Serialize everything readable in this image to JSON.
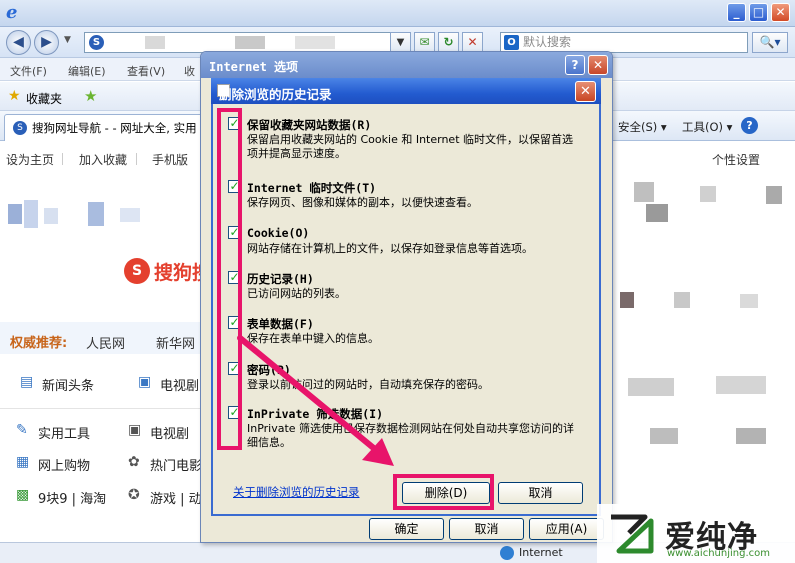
{
  "browser": {
    "window_controls": {
      "minimize": "_",
      "maximize": "□",
      "close": "✕"
    },
    "nav": {
      "back": "◀",
      "forward": "▶",
      "dropdown": "▼"
    },
    "address_site_icon": "S",
    "toolbar_icons": {
      "compat": "✉",
      "refresh": "↻",
      "stop": "✕"
    },
    "search": {
      "placeholder": "默认搜索",
      "engine_icon": "O",
      "button": "🔍▾"
    },
    "menu": [
      "文件(F)",
      "编辑(E)",
      "查看(V)",
      "收"
    ],
    "favorites": {
      "label": "收藏夹"
    },
    "tab": {
      "icon": "S",
      "title": "搜狗网址导航 - - 网址大全, 实用"
    },
    "commands": {
      "security": "安全(S) ▾",
      "tools": "工具(O) ▾",
      "help": "?"
    },
    "status": {
      "zone": "Internet"
    }
  },
  "webpage": {
    "top_links": [
      "设为主页",
      "加入收藏",
      "手机版"
    ],
    "personalize": "个性设置",
    "logo_text": "搜狗搜",
    "authority": {
      "label": "权威推荐:",
      "links": [
        "人民网",
        "新华网"
      ]
    },
    "categories": [
      {
        "icon": "▤",
        "label": "新闻头条"
      },
      {
        "icon": "▣",
        "label": "电视剧"
      },
      {
        "icon": "✎",
        "label": "实用工具"
      },
      {
        "icon": "▣",
        "label": "电视剧"
      },
      {
        "icon": "▦",
        "label": "网上购物"
      },
      {
        "icon": "✿",
        "label": "热门电影"
      },
      {
        "icon": "▩",
        "label": "9块9 | 海淘"
      },
      {
        "icon": "✪",
        "label": "游戏 | 动"
      }
    ]
  },
  "internet_options": {
    "title": "Internet 选项",
    "help": "?",
    "close": "✕",
    "buttons": {
      "ok": "确定",
      "cancel": "取消",
      "apply": "应用(A)"
    }
  },
  "delete_history": {
    "title": "删除浏览的历史记录",
    "close": "✕",
    "options": [
      {
        "checked": true,
        "title": "保留收藏夹网站数据(R)",
        "desc": "保留启用收藏夹网站的 Cookie 和 Internet 临时文件，以保留首选项并提高显示速度。"
      },
      {
        "checked": true,
        "title": "Internet 临时文件(T)",
        "desc": "保存网页、图像和媒体的副本，以便快速查看。"
      },
      {
        "checked": true,
        "title": "Cookie(O)",
        "desc": "网站存储在计算机上的文件，以保存如登录信息等首选项。"
      },
      {
        "checked": true,
        "title": "历史记录(H)",
        "desc": "已访问网站的列表。"
      },
      {
        "checked": true,
        "title": "表单数据(F)",
        "desc": "保存在表单中键入的信息。"
      },
      {
        "checked": true,
        "title": "密码(P)",
        "desc": "登录以前访问过的网站时，自动填充保存的密码。"
      },
      {
        "checked": true,
        "title": "InPrivate 筛选数据(I)",
        "desc": "InPrivate 筛选使用已保存数据检测网站在何处自动共享您访问的详细信息。"
      }
    ],
    "about_link": "关于删除浏览的历史记录",
    "delete_button": "删除(D)",
    "cancel_button": "取消"
  },
  "watermark": {
    "brand": "爱纯净",
    "url": "www.aichunjing.com"
  },
  "colors": {
    "annotation": "#e8146a",
    "xp_title": "#235bd0",
    "dialog_bg": "#ece9d8"
  }
}
